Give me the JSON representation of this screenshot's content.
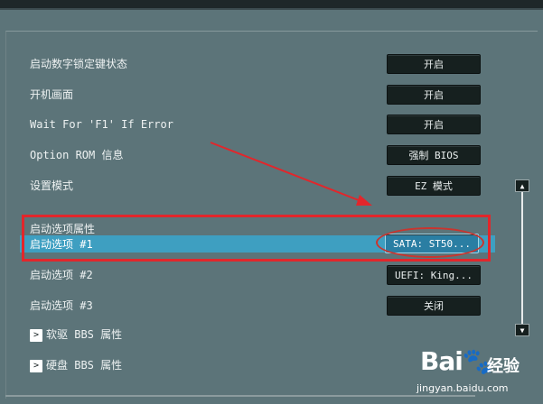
{
  "rows": [
    {
      "label": "启动数字锁定键状态",
      "value": "开启"
    },
    {
      "label": "开机画面",
      "value": "开启"
    },
    {
      "label": "Wait For 'F1' If Error",
      "value": "开启"
    },
    {
      "label": "Option ROM 信息",
      "value": "强制 BIOS"
    },
    {
      "label": "设置模式",
      "value": "EZ 模式"
    }
  ],
  "boot_section": {
    "header": "启动选项属性",
    "selected": {
      "label": "启动选项 #1",
      "value": "SATA: ST50..."
    }
  },
  "boot_rows": [
    {
      "label": "启动选项 #2",
      "value": "UEFI: King..."
    },
    {
      "label": "启动选项 #3",
      "value": "关闭"
    }
  ],
  "submenus": [
    {
      "arrow": ">",
      "label": "软驱 BBS 属性"
    },
    {
      "arrow": ">",
      "label": "硬盘 BBS 属性"
    }
  ],
  "scrollbar": {
    "up": "▲",
    "down": "▼"
  },
  "watermark": {
    "logo_left": "Bai",
    "logo_right": "经验",
    "url": "jingyan.baidu.com"
  },
  "colors": {
    "highlight": "#3e9fc1",
    "annotation": "#e2262b"
  }
}
